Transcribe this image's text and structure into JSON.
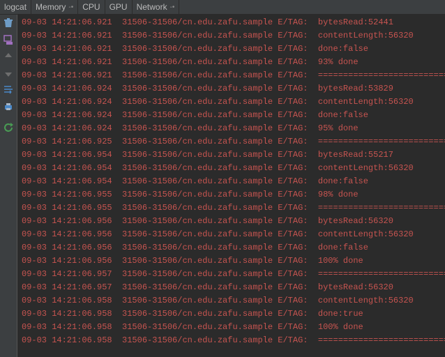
{
  "tabs": {
    "items": [
      {
        "label": "logcat"
      },
      {
        "label": "Memory"
      },
      {
        "label": "CPU"
      },
      {
        "label": "GPU"
      },
      {
        "label": "Network"
      }
    ]
  },
  "log": {
    "lines": [
      {
        "ts": "09-03 14:21:06.921",
        "pid": "31506-31506/cn.edu.zafu.sample",
        "tag": "E/TAG:",
        "msg": "bytesRead:52441"
      },
      {
        "ts": "09-03 14:21:06.921",
        "pid": "31506-31506/cn.edu.zafu.sample",
        "tag": "E/TAG:",
        "msg": "contentLength:56320"
      },
      {
        "ts": "09-03 14:21:06.921",
        "pid": "31506-31506/cn.edu.zafu.sample",
        "tag": "E/TAG:",
        "msg": "done:false"
      },
      {
        "ts": "09-03 14:21:06.921",
        "pid": "31506-31506/cn.edu.zafu.sample",
        "tag": "E/TAG:",
        "msg": "93% done"
      },
      {
        "ts": "09-03 14:21:06.921",
        "pid": "31506-31506/cn.edu.zafu.sample",
        "tag": "E/TAG:",
        "msg": "==================================="
      },
      {
        "ts": "09-03 14:21:06.924",
        "pid": "31506-31506/cn.edu.zafu.sample",
        "tag": "E/TAG:",
        "msg": "bytesRead:53829"
      },
      {
        "ts": "09-03 14:21:06.924",
        "pid": "31506-31506/cn.edu.zafu.sample",
        "tag": "E/TAG:",
        "msg": "contentLength:56320"
      },
      {
        "ts": "09-03 14:21:06.924",
        "pid": "31506-31506/cn.edu.zafu.sample",
        "tag": "E/TAG:",
        "msg": "done:false"
      },
      {
        "ts": "09-03 14:21:06.924",
        "pid": "31506-31506/cn.edu.zafu.sample",
        "tag": "E/TAG:",
        "msg": "95% done"
      },
      {
        "ts": "09-03 14:21:06.925",
        "pid": "31506-31506/cn.edu.zafu.sample",
        "tag": "E/TAG:",
        "msg": "==================================="
      },
      {
        "ts": "09-03 14:21:06.954",
        "pid": "31506-31506/cn.edu.zafu.sample",
        "tag": "E/TAG:",
        "msg": "bytesRead:55217"
      },
      {
        "ts": "09-03 14:21:06.954",
        "pid": "31506-31506/cn.edu.zafu.sample",
        "tag": "E/TAG:",
        "msg": "contentLength:56320"
      },
      {
        "ts": "09-03 14:21:06.954",
        "pid": "31506-31506/cn.edu.zafu.sample",
        "tag": "E/TAG:",
        "msg": "done:false"
      },
      {
        "ts": "09-03 14:21:06.955",
        "pid": "31506-31506/cn.edu.zafu.sample",
        "tag": "E/TAG:",
        "msg": "98% done"
      },
      {
        "ts": "09-03 14:21:06.955",
        "pid": "31506-31506/cn.edu.zafu.sample",
        "tag": "E/TAG:",
        "msg": "==================================="
      },
      {
        "ts": "09-03 14:21:06.956",
        "pid": "31506-31506/cn.edu.zafu.sample",
        "tag": "E/TAG:",
        "msg": "bytesRead:56320"
      },
      {
        "ts": "09-03 14:21:06.956",
        "pid": "31506-31506/cn.edu.zafu.sample",
        "tag": "E/TAG:",
        "msg": "contentLength:56320"
      },
      {
        "ts": "09-03 14:21:06.956",
        "pid": "31506-31506/cn.edu.zafu.sample",
        "tag": "E/TAG:",
        "msg": "done:false"
      },
      {
        "ts": "09-03 14:21:06.956",
        "pid": "31506-31506/cn.edu.zafu.sample",
        "tag": "E/TAG:",
        "msg": "100% done"
      },
      {
        "ts": "09-03 14:21:06.957",
        "pid": "31506-31506/cn.edu.zafu.sample",
        "tag": "E/TAG:",
        "msg": "==================================="
      },
      {
        "ts": "09-03 14:21:06.957",
        "pid": "31506-31506/cn.edu.zafu.sample",
        "tag": "E/TAG:",
        "msg": "bytesRead:56320"
      },
      {
        "ts": "09-03 14:21:06.958",
        "pid": "31506-31506/cn.edu.zafu.sample",
        "tag": "E/TAG:",
        "msg": "contentLength:56320"
      },
      {
        "ts": "09-03 14:21:06.958",
        "pid": "31506-31506/cn.edu.zafu.sample",
        "tag": "E/TAG:",
        "msg": "done:true"
      },
      {
        "ts": "09-03 14:21:06.958",
        "pid": "31506-31506/cn.edu.zafu.sample",
        "tag": "E/TAG:",
        "msg": "100% done"
      },
      {
        "ts": "09-03 14:21:06.958",
        "pid": "31506-31506/cn.edu.zafu.sample",
        "tag": "E/TAG:",
        "msg": "==================================="
      }
    ]
  }
}
